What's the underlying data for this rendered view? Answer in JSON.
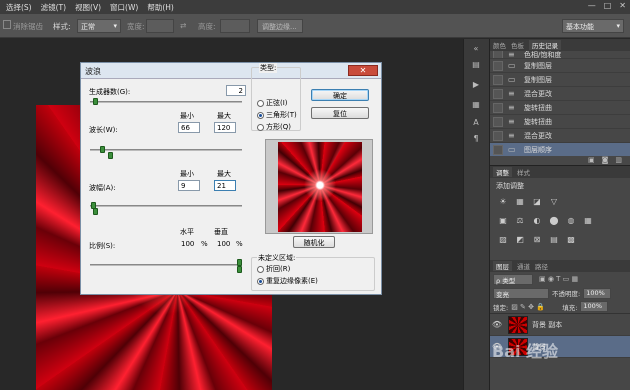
{
  "menubar": {
    "items": [
      "选择(S)",
      "滤镜(T)",
      "视图(V)",
      "窗口(W)",
      "帮助(H)"
    ],
    "window_controls": [
      "—",
      "□",
      "✕"
    ]
  },
  "options": {
    "clear_label": "消除锯齿",
    "style_label": "样式:",
    "style_value": "正常",
    "width_label": "宽度:",
    "height_label": "高度:",
    "refine_button": "调整边缘...",
    "workspace": "基本功能"
  },
  "history_panel": {
    "tabs": [
      "颜色",
      "色板",
      "历史记录"
    ],
    "active_tab": "历史记录",
    "items": [
      {
        "label": "色相/饱和度",
        "icon": "≡"
      },
      {
        "label": "复制图层",
        "icon": "▭"
      },
      {
        "label": "复制图层",
        "icon": "▭"
      },
      {
        "label": "混合更改",
        "icon": "≡"
      },
      {
        "label": "旋转扭曲",
        "icon": "≡"
      },
      {
        "label": "旋转扭曲",
        "icon": "≡"
      },
      {
        "label": "混合更改",
        "icon": "≡"
      },
      {
        "label": "图层顺序",
        "icon": "▭",
        "selected": true
      }
    ]
  },
  "adjust_panel": {
    "tabs": [
      "调整",
      "样式"
    ],
    "title": "添加调整",
    "icons": [
      "☀",
      "▦",
      "◪",
      "▽",
      "",
      "",
      "▣",
      "⚖",
      "◐",
      "⬤",
      "◍",
      "▦",
      "▨",
      "◩",
      "⊠",
      "▤",
      "▩",
      ""
    ]
  },
  "layers_panel": {
    "tabs": [
      "图层",
      "通道",
      "路径"
    ],
    "kind_label": "ρ 类型",
    "blend_mode": "变亮",
    "opacity_label": "不透明度:",
    "opacity_value": "100%",
    "lock_label": "锁定:",
    "fill_label": "填充:",
    "fill_value": "100%",
    "layers": [
      {
        "name": "背景 副本"
      },
      {
        "name": "背景"
      }
    ]
  },
  "dialog": {
    "title": "波浪",
    "generators_label": "生成器数(G):",
    "generators_value": "2",
    "wavelength_label": "波长(W):",
    "wavelength_min_label": "最小",
    "wavelength_max_label": "最大",
    "wavelength_min": "66",
    "wavelength_max": "120",
    "amplitude_label": "波幅(A):",
    "amplitude_min_label": "最小",
    "amplitude_max_label": "最大",
    "amplitude_min": "9",
    "amplitude_max": "21",
    "scale_label": "比例(S):",
    "scale_h_label": "水平",
    "scale_v_label": "垂直",
    "scale_h": "100",
    "scale_v": "100",
    "percent": "%",
    "type_label": "类型:",
    "type_options": [
      "正弦(I)",
      "三角形(T)",
      "方形(Q)"
    ],
    "type_selected": "三角形(T)",
    "ok_button": "确定",
    "reset_button": "复位",
    "randomize_button": "随机化",
    "undefined_label": "未定义区域:",
    "undefined_options": [
      "折回(R)",
      "重复边缘像素(E)"
    ],
    "undefined_selected": "重复边缘像素(E)",
    "slider_levels": {
      "generators": 0.02,
      "wavelength_min": 0.07,
      "wavelength_max": 0.12,
      "amplitude_min": 0.01,
      "amplitude_max": 0.02,
      "scale_h": 1.0,
      "scale_v": 1.0
    }
  },
  "watermark": "Bai 经验"
}
